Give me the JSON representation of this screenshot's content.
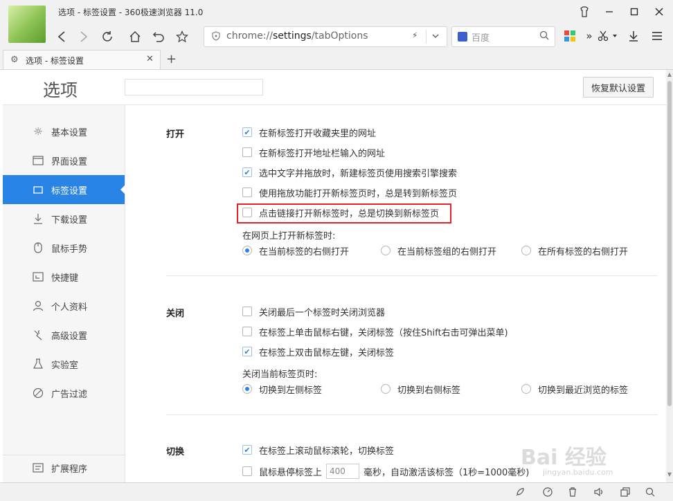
{
  "window": {
    "title": "选项 - 标签设置 - 360极速浏览器 11.0"
  },
  "toolbar": {
    "url_prefix": "chrome://",
    "url_host": "settings",
    "url_path": "/tabOptions",
    "search_engine_placeholder": "百度",
    "double_arrow": "»"
  },
  "tab": {
    "label": "选项 - 标签设置"
  },
  "page": {
    "title": "选项",
    "reset_button": "恢复默认设置"
  },
  "sidebar": {
    "items": [
      {
        "label": "基本设置",
        "icon": "sun-icon"
      },
      {
        "label": "界面设置",
        "icon": "window-icon"
      },
      {
        "label": "标签设置",
        "icon": "tab-icon",
        "active": true
      },
      {
        "label": "下载设置",
        "icon": "download-icon"
      },
      {
        "label": "鼠标手势",
        "icon": "mouse-icon"
      },
      {
        "label": "快捷键",
        "icon": "shortcut-icon"
      },
      {
        "label": "个人资料",
        "icon": "person-icon"
      },
      {
        "label": "高级设置",
        "icon": "advanced-icon"
      },
      {
        "label": "实验室",
        "icon": "flask-icon"
      },
      {
        "label": "广告过滤",
        "icon": "block-icon"
      }
    ],
    "extensions": {
      "label": "扩展程序",
      "icon": "extensions-icon"
    }
  },
  "sections": {
    "open": {
      "label": "打开",
      "options": [
        {
          "label": "在新标签打开收藏夹里的网址",
          "checked": true
        },
        {
          "label": "在新标签打开地址栏输入的网址",
          "checked": false
        },
        {
          "label": "选中文字并拖放时，新建标签页使用搜索引擎搜索",
          "checked": true
        },
        {
          "label": "使用拖放功能打开新标签页时，总是转到新标签页",
          "checked": false
        },
        {
          "label": "点击链接打开新标签时，总是切换到新标签页",
          "checked": false
        }
      ],
      "sub_label": "在网页上打开新标签时:",
      "radios": [
        {
          "label": "在当前标签的右侧打开",
          "checked": true
        },
        {
          "label": "在当前标签组的右侧打开",
          "checked": false
        },
        {
          "label": "在所有标签的右侧打开",
          "checked": false
        }
      ]
    },
    "close": {
      "label": "关闭",
      "options": [
        {
          "label": "关闭最后一个标签时关闭浏览器",
          "checked": false
        },
        {
          "label": "在标签上单击鼠标右键，关闭标签（按住Shift右击可弹出菜单)",
          "checked": false
        },
        {
          "label": "在标签上双击鼠标左键，关闭标签",
          "checked": true
        }
      ],
      "sub_label": "关闭当前标签页时:",
      "radios": [
        {
          "label": "切换到左侧标签",
          "checked": true
        },
        {
          "label": "切换到右侧标签",
          "checked": false
        },
        {
          "label": "切换到最近浏览的标签",
          "checked": false
        }
      ]
    },
    "switch": {
      "label": "切换",
      "options": [
        {
          "label": "在标签上滚动鼠标滚轮，切换标签",
          "checked": true
        }
      ],
      "hover_prefix": "鼠标悬停标签上",
      "hover_value": "400",
      "hover_suffix": "毫秒，自动激活该标签（1秒=1000毫秒)",
      "hover_checked": false
    }
  },
  "watermark": {
    "text": "Bai 经验",
    "sub": "jingyan.baidu.com"
  },
  "colors": {
    "accent": "#2a84e6",
    "highlight_border": "#e5232a",
    "sidebar_bg": "#f6f6f6"
  }
}
